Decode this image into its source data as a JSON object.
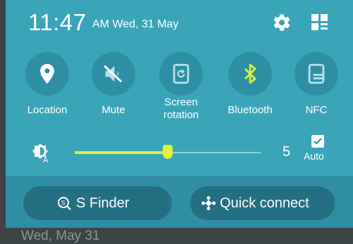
{
  "header": {
    "time": "11:47",
    "date": "AM Wed, 31 May",
    "settings_icon": "gear-icon",
    "edit_icon": "grid-edit-icon"
  },
  "toggles": [
    {
      "label": "Location",
      "icon": "location-pin-icon",
      "active": false
    },
    {
      "label": "Mute",
      "icon": "speaker-muted-icon",
      "active": false
    },
    {
      "label": "Screen rotation",
      "icon": "screen-rotation-icon",
      "active": false
    },
    {
      "label": "Bluetooth",
      "icon": "bluetooth-icon",
      "active": true
    },
    {
      "label": "NFC",
      "icon": "nfc-icon",
      "active": false
    }
  ],
  "brightness": {
    "icon": "brightness-auto-icon",
    "value": "5",
    "level_fraction": 0.5,
    "auto_label": "Auto",
    "auto_checked": true
  },
  "buttons": {
    "s_finder": "S Finder",
    "quick_connect": "Quick connect"
  },
  "underlay": {
    "date_text": "Wed, May 31"
  },
  "colors": {
    "panel": "#3aa5b9",
    "toggle_circle": "#2d8fa3",
    "accent": "#e4f136",
    "pill": "#246f82"
  }
}
